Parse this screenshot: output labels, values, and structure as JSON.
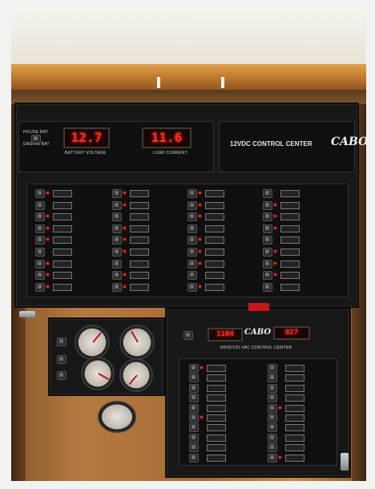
{
  "dc_panel": {
    "title": "12VDC CONTROL CENTER",
    "brand": "CABO",
    "house_bat_label": "HOUSE BAT",
    "engine_bat_label": "ENGINE BAT",
    "battery_voltage_label": "BATTERY VOLTAGE",
    "battery_voltage_value": "12.7",
    "load_current_label": "LOAD CURRENT",
    "load_current_value": "11.6"
  },
  "ac_panel": {
    "title": "60HZ/120-VAC CONTROL CENTER",
    "brand": "CABO",
    "voltage_value": "1104",
    "current_value": "027"
  },
  "colors": {
    "led": "#ff3318",
    "wood": "#a56a34",
    "panel": "#171717"
  }
}
